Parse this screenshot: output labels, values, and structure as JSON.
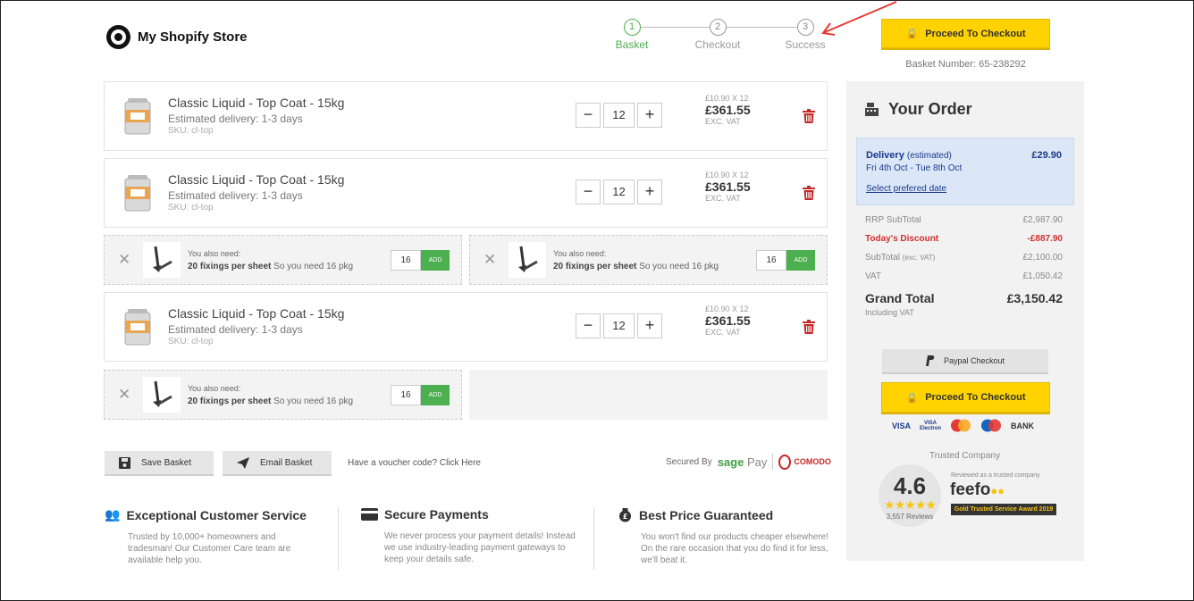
{
  "header": {
    "store_name": "My Shopify Store",
    "steps": [
      {
        "num": "1",
        "label": "Basket"
      },
      {
        "num": "2",
        "label": "Checkout"
      },
      {
        "num": "3",
        "label": "Success"
      }
    ],
    "checkout_label": "Proceed To Checkout",
    "basket_number": "Basket Number: 65-238292"
  },
  "items": [
    {
      "name": "Classic Liquid - Top Coat - 15kg",
      "delivery": "Estimated delivery: 1-3 days",
      "sku": "SKU: cl-top",
      "qty": "12",
      "unit": "£10.90 X 12",
      "total": "£361.55",
      "vat": "EXC. VAT"
    },
    {
      "name": "Classic Liquid - Top Coat - 15kg",
      "delivery": "Estimated delivery: 1-3 days",
      "sku": "SKU: cl-top",
      "qty": "12",
      "unit": "£10.90 X 12",
      "total": "£361.55",
      "vat": "EXC. VAT"
    },
    {
      "name": "Classic Liquid - Top Coat - 15kg",
      "delivery": "Estimated delivery: 1-3 days",
      "sku": "SKU: cl-top",
      "qty": "12",
      "unit": "£10.90 X 12",
      "total": "£361.55",
      "vat": "EXC. VAT"
    }
  ],
  "accessories": [
    {
      "line1": "You also need:",
      "bold": "20 fixings per sheet",
      "rest": " So you need 16 pkg",
      "qty": "16",
      "add": "ADD"
    },
    {
      "line1": "You also need:",
      "bold": "20 fixings per sheet",
      "rest": " So you need 16 pkg",
      "qty": "16",
      "add": "ADD"
    },
    {
      "line1": "You also need:",
      "bold": "20 fixings per sheet",
      "rest": " So you need 16 pkg",
      "qty": "16",
      "add": "ADD"
    }
  ],
  "actions": {
    "save": "Save Basket",
    "email": "Email Basket",
    "voucher": "Have a voucher code? Click Here",
    "secured_by": "Secured By",
    "sage": "sage",
    "pay": "Pay",
    "comodo": "COMODO"
  },
  "features": [
    {
      "title": "Exceptional Customer Service",
      "desc": "Trusted by 10,000+ homeowners and tradesman! Our Customer Care team are available help you."
    },
    {
      "title": "Secure Payments",
      "desc": "We never process your payment details! Instead we use industry-leading payment gateways to keep your details safe."
    },
    {
      "title": "Best Price Guaranteed",
      "desc": "You won't find our products cheaper elsewhere! On the rare occasion that you do find it for less, we'll beat it."
    }
  ],
  "order": {
    "title": "Your Order",
    "delivery_label": "Delivery",
    "delivery_est": "(estimated)",
    "delivery_dates": "Fri 4th Oct - Tue 8th Oct",
    "delivery_amount": "£29.90",
    "select_date": "Select prefered date",
    "rrp_label": "RRP SubTotal",
    "rrp": "£2,987.90",
    "discount_label": "Today's Discount",
    "discount": "-£887.90",
    "subtotal_label": "SubTotal",
    "subtotal_note": "(exc. VAT)",
    "subtotal": "£2,100.00",
    "vat_label": "VAT",
    "vat": "£1,050.42",
    "grand_label": "Grand Total",
    "grand": "£3,150.42",
    "incl": "Including VAT",
    "paypal": "Paypal Checkout",
    "checkout": "Proceed To Checkout",
    "cards": [
      "VISA",
      "VISA Electron",
      "",
      "",
      "BANK"
    ],
    "trusted": "Trusted Company",
    "score": "4.6",
    "stars": "★★★★★",
    "reviews": "3,557 Reviews",
    "reviewed": "Reviewed as a trusted company",
    "feefo": "feefo",
    "award": "Gold Trusted Service Award 2019"
  },
  "colors": {
    "accent_green": "#4caf50",
    "checkout_yellow": "#ffd200",
    "discount_red": "#d32f2f",
    "delivery_blue": "#1a3a8a",
    "annotation_arrow": "#e53935"
  }
}
